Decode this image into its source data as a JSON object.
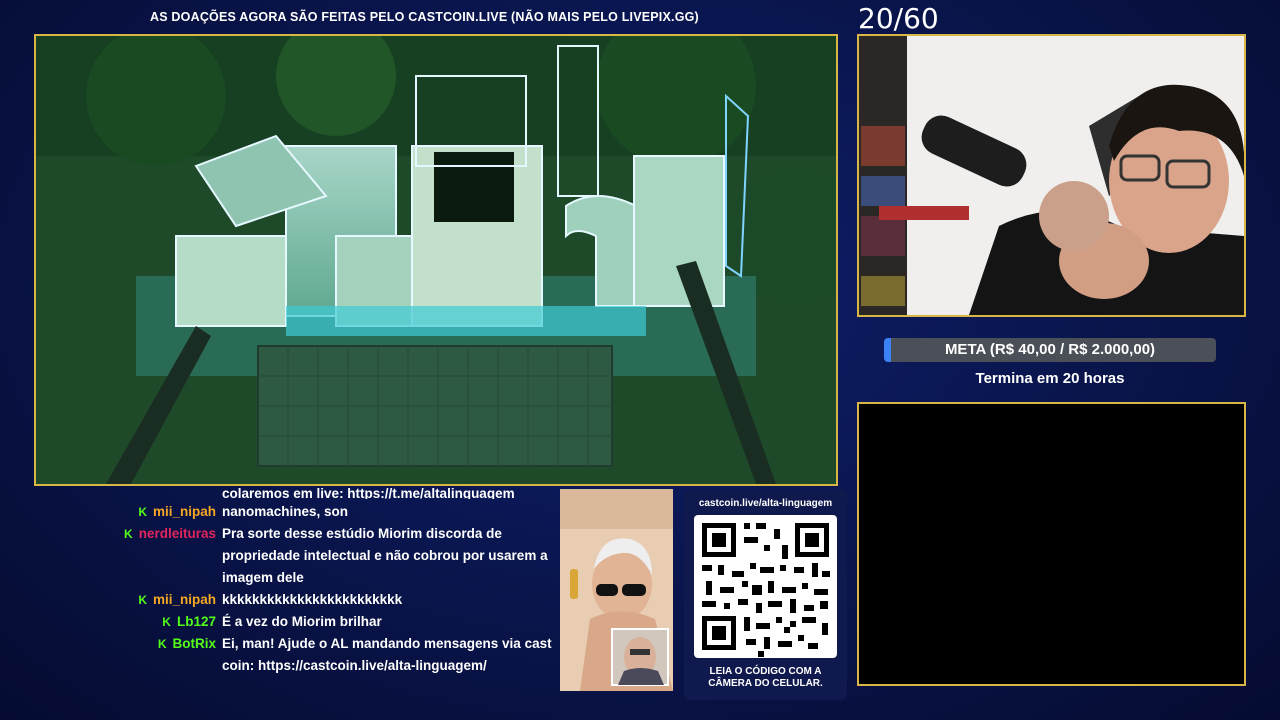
{
  "banner": "AS DOAÇÕES AGORA SÃO FEITAS PELO CASTCOIN.LIVE (NÃO MAIS PELO LIVEPIX.GG)",
  "counter": "20/60",
  "goal": {
    "label": "META (R$ 40,00 / R$ 2.000,00)",
    "progress_percent": 2,
    "ends": "Termina em 20 horas"
  },
  "chat": {
    "cutoff_text": "colaremos em live: https://t.me/altalinguagem",
    "messages": [
      {
        "user": "mii_nipah",
        "color": "#f5a623",
        "icon": "kick-icon",
        "text": "nanomachines, son"
      },
      {
        "user": "nerdleituras",
        "color": "#e0245e",
        "icon": "kick-icon",
        "text": "Pra sorte desse estúdio Miorim discorda de propriedade intelectual e não cobrou por usarem a imagem dele"
      },
      {
        "user": "mii_nipah",
        "color": "#f5a623",
        "icon": "kick-icon",
        "text": "kkkkkkkkkkkkkkkkkkkkkkkk"
      },
      {
        "user": "Lb127",
        "color": "#53fc18",
        "icon": "kick-icon",
        "text": "É a vez do Miorim brilhar"
      },
      {
        "user": "BotRix",
        "color": "#53fc18",
        "icon": "kick-icon",
        "text": "Ei, man! Ajude o AL mandando mensagens via cast coin: https://castcoin.live/alta-linguagem/"
      }
    ]
  },
  "qr": {
    "url": "castcoin.live/alta-linguagem",
    "caption_line1": "LEIA O CÓDIGO COM A",
    "caption_line2": "CÂMERA DO CELULAR."
  },
  "colors": {
    "accent_border": "#d8b646",
    "kick_green": "#53fc18",
    "progress": "#3b82f6"
  }
}
